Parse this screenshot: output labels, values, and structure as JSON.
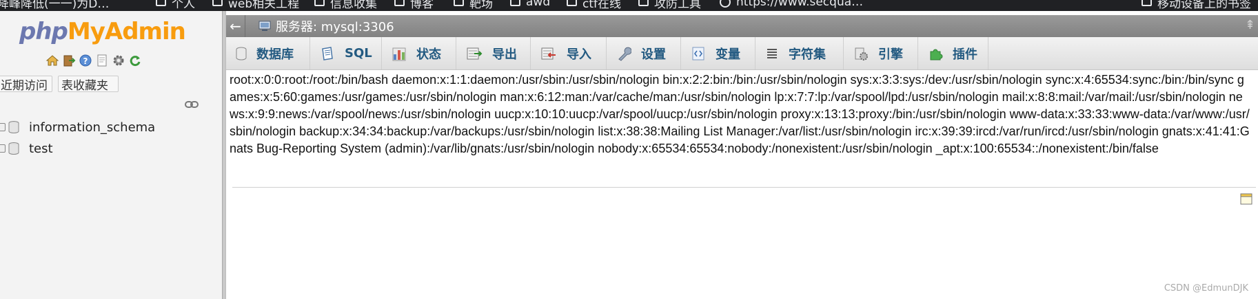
{
  "browser": {
    "bookmarks": [
      {
        "label": "降峰降低(一一)为D…",
        "icon": "folder-icon"
      },
      {
        "label": "个人",
        "icon": "folder-icon"
      },
      {
        "label": "web相关工程",
        "icon": "folder-icon"
      },
      {
        "label": "信息收集",
        "icon": "folder-icon"
      },
      {
        "label": "博客",
        "icon": "folder-icon"
      },
      {
        "label": "靶场",
        "icon": "folder-icon"
      },
      {
        "label": "awd",
        "icon": "folder-icon"
      },
      {
        "label": "ctf在线",
        "icon": "folder-icon"
      },
      {
        "label": "攻防工具",
        "icon": "folder-icon"
      },
      {
        "label": "https://www.secqua…",
        "icon": "globe-icon"
      },
      {
        "label": "移动设备上的书签",
        "icon": "folder-icon"
      }
    ]
  },
  "sidebar": {
    "logo_php": "php",
    "logo_myadmin": "MyAdmin",
    "nav_icons": [
      "home-icon",
      "exit-icon",
      "help-icon",
      "docs-icon",
      "settings-icon",
      "reload-icon"
    ],
    "recent_tab": "近期访问",
    "favorites_tab": "表收藏夹",
    "databases": [
      "information_schema",
      "test"
    ]
  },
  "header": {
    "server_label": "服务器: mysql:3306"
  },
  "menu": {
    "items": [
      {
        "label": "数据库",
        "icon": "database-icon"
      },
      {
        "label": "SQL",
        "icon": "sql-icon"
      },
      {
        "label": "状态",
        "icon": "status-icon"
      },
      {
        "label": "导出",
        "icon": "export-icon"
      },
      {
        "label": "导入",
        "icon": "import-icon"
      },
      {
        "label": "设置",
        "icon": "wrench-icon"
      },
      {
        "label": "变量",
        "icon": "variables-icon"
      },
      {
        "label": "字符集",
        "icon": "charset-icon"
      },
      {
        "label": "引擎",
        "icon": "engine-icon"
      },
      {
        "label": "插件",
        "icon": "plugin-icon"
      }
    ]
  },
  "main": {
    "output_text": "root:x:0:0:root:/root:/bin/bash daemon:x:1:1:daemon:/usr/sbin:/usr/sbin/nologin bin:x:2:2:bin:/bin:/usr/sbin/nologin sys:x:3:3:sys:/dev:/usr/sbin/nologin sync:x:4:65534:sync:/bin:/bin/sync games:x:5:60:games:/usr/games:/usr/sbin/nologin man:x:6:12:man:/var/cache/man:/usr/sbin/nologin lp:x:7:7:lp:/var/spool/lpd:/usr/sbin/nologin mail:x:8:8:mail:/var/mail:/usr/sbin/nologin news:x:9:9:news:/var/spool/news:/usr/sbin/nologin uucp:x:10:10:uucp:/var/spool/uucp:/usr/sbin/nologin proxy:x:13:13:proxy:/bin:/usr/sbin/nologin www-data:x:33:33:www-data:/var/www:/usr/sbin/nologin backup:x:34:34:backup:/var/backups:/usr/sbin/nologin list:x:38:38:Mailing List Manager:/var/list:/usr/sbin/nologin irc:x:39:39:ircd:/var/run/ircd:/usr/sbin/nologin gnats:x:41:41:Gnats Bug-Reporting System (admin):/var/lib/gnats:/usr/sbin/nologin nobody:x:65534:65534:nobody:/nonexistent:/usr/sbin/nologin _apt:x:100:65534::/nonexistent:/bin/false"
  },
  "watermark": "CSDN @EdmunDJK",
  "colors": {
    "menu_text": "#235a81",
    "logo_php": "#6c78af",
    "logo_myadmin": "#f89c0e",
    "topbar": "#8e8e8e"
  }
}
